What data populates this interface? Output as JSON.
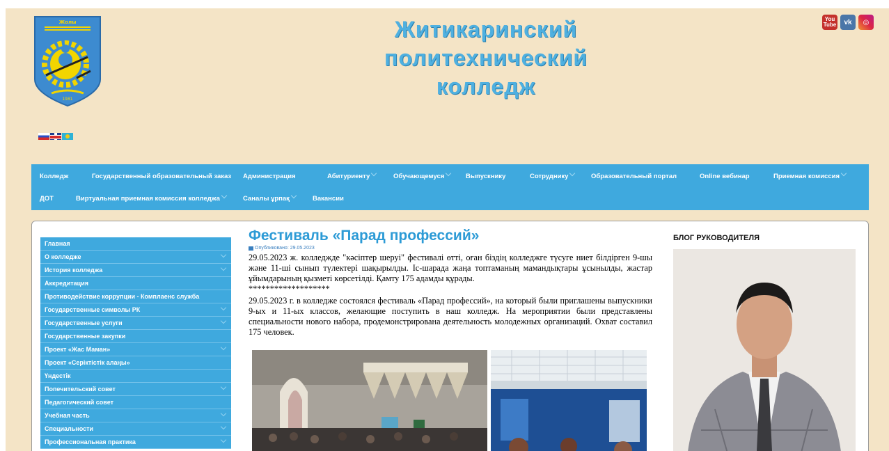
{
  "header": {
    "title_lines": [
      "Житикаринский",
      "политехнический",
      "колледж"
    ]
  },
  "social": {
    "youtube_top": "You",
    "youtube_bottom": "Tube",
    "vk": "vk",
    "instagram": "◎"
  },
  "topnav": [
    {
      "label": "Колледж",
      "has_children": false
    },
    {
      "label": "Государственный образовательный заказ",
      "has_children": false
    },
    {
      "label": "Администрация",
      "has_children": false
    },
    {
      "label": "Абитуриенту",
      "has_children": true
    },
    {
      "label": "Обучающемуся",
      "has_children": true
    },
    {
      "label": "Выпускнику",
      "has_children": false
    },
    {
      "label": "Сотруднику",
      "has_children": true
    },
    {
      "label": "Образовательный портал",
      "has_children": false
    },
    {
      "label": "Online вебинар",
      "has_children": false
    },
    {
      "label": "Приемная комиссия",
      "has_children": true
    },
    {
      "label": "ДОТ",
      "has_children": false
    },
    {
      "label": "Виртуальная приемная комиссия колледжа",
      "has_children": true
    },
    {
      "label": "Саналы ұрпақ",
      "has_children": true
    },
    {
      "label": "Вакансии",
      "has_children": false
    }
  ],
  "sidemenu": [
    {
      "label": "Главная",
      "has_children": false
    },
    {
      "label": "О колледже",
      "has_children": true
    },
    {
      "label": "История колледжа",
      "has_children": true
    },
    {
      "label": "Аккредитация",
      "has_children": false
    },
    {
      "label": "Противодействие коррупции - Комплаенс служба",
      "has_children": false
    },
    {
      "label": "Государственные символы РК",
      "has_children": true
    },
    {
      "label": "Государственные услуги",
      "has_children": true
    },
    {
      "label": "Государственные закупки",
      "has_children": false
    },
    {
      "label": "Проект «Жас Маман»",
      "has_children": true
    },
    {
      "label": "Проект «Серіктістік алаңы»",
      "has_children": false
    },
    {
      "label": "Үндестік",
      "has_children": false
    },
    {
      "label": "Попечительский совет",
      "has_children": true
    },
    {
      "label": "Педагогический совет",
      "has_children": false
    },
    {
      "label": "Учебная часть",
      "has_children": true
    },
    {
      "label": "Специальности",
      "has_children": true
    },
    {
      "label": "Профессиональная практика",
      "has_children": true
    }
  ],
  "article": {
    "title": "Фестиваль «Парад профессий»",
    "published": "Опубликовано: 29.05.2023",
    "para_kz": "29.05.2023 ж. колледжде \"кәсіптер шеруі\" фестивалі өтті, оған біздің колледжге түсуге ниет білдірген 9-шы және 11-ші сынып түлектері шақырылды. Іс-шарада жаңа топтаманың мамандықтары ұсынылды, жастар ұйымдарының қызметі көрсетілді. Қамту 175 адамды құрады.",
    "separator": "*******************",
    "para_ru": "29.05.2023 г. в колледже состоялся фестиваль «Парад профессий», на который были приглашены выпускники 9-ых и 11-ых классов, желающие поступить в наш колледж. На мероприятии были представлены специальности нового набора, продемонстрирована деятельность молодежных организаций. Охват составил 175 человек."
  },
  "blog": {
    "title": "БЛОГ РУКОВОДИТЕЛЯ"
  },
  "colors": {
    "page_bg": "#f4e4c6",
    "nav_bg": "#3fa9de",
    "title_blue": "#4fb0e0",
    "heading_blue": "#2d9bd6"
  }
}
